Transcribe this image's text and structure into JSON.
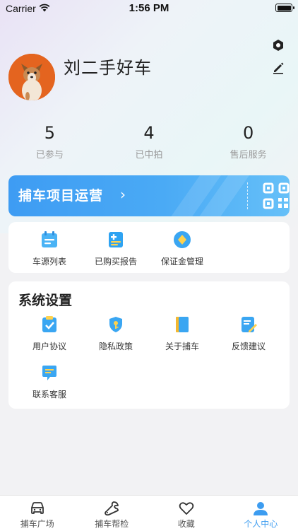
{
  "status_bar": {
    "carrier": "Carrier",
    "time": "1:56 PM"
  },
  "header": {
    "settings_icon": "hexagon-settings-icon",
    "edit_icon": "edit-pencil-icon"
  },
  "profile": {
    "username": "刘二手好车",
    "avatar": "corgi-dog-photo"
  },
  "stats": [
    {
      "value": "5",
      "label": "已参与"
    },
    {
      "value": "4",
      "label": "已中拍"
    },
    {
      "value": "0",
      "label": "售后服务"
    }
  ],
  "banner": {
    "title": "捕车项目运营",
    "arrow": "›",
    "icon": "qr-code-icon"
  },
  "quick_actions": [
    {
      "label": "车源列表",
      "icon": "calendar-list-icon"
    },
    {
      "label": "已购买报告",
      "icon": "report-add-icon"
    },
    {
      "label": "保证金管理",
      "icon": "deposit-diamond-icon"
    }
  ],
  "system_settings": {
    "title": "系统设置",
    "items": [
      {
        "label": "用户协议",
        "icon": "agreement-clipboard-icon"
      },
      {
        "label": "隐私政策",
        "icon": "privacy-shield-icon"
      },
      {
        "label": "关于捕车",
        "icon": "book-icon"
      },
      {
        "label": "反馈建议",
        "icon": "feedback-edit-icon"
      },
      {
        "label": "联系客服",
        "icon": "chat-bubble-icon"
      }
    ]
  },
  "tabbar": [
    {
      "label": "捕车广场",
      "icon": "car-icon",
      "active": false
    },
    {
      "label": "捕车帮检",
      "icon": "wrench-check-icon",
      "active": false
    },
    {
      "label": "收藏",
      "icon": "heart-icon",
      "active": false
    },
    {
      "label": "个人中心",
      "icon": "person-icon",
      "active": true
    }
  ],
  "colors": {
    "accent": "#3c9cf0",
    "banner_start": "#3e9cf3",
    "banner_end": "#66c0f8",
    "avatar_bg": "#e4641f"
  }
}
